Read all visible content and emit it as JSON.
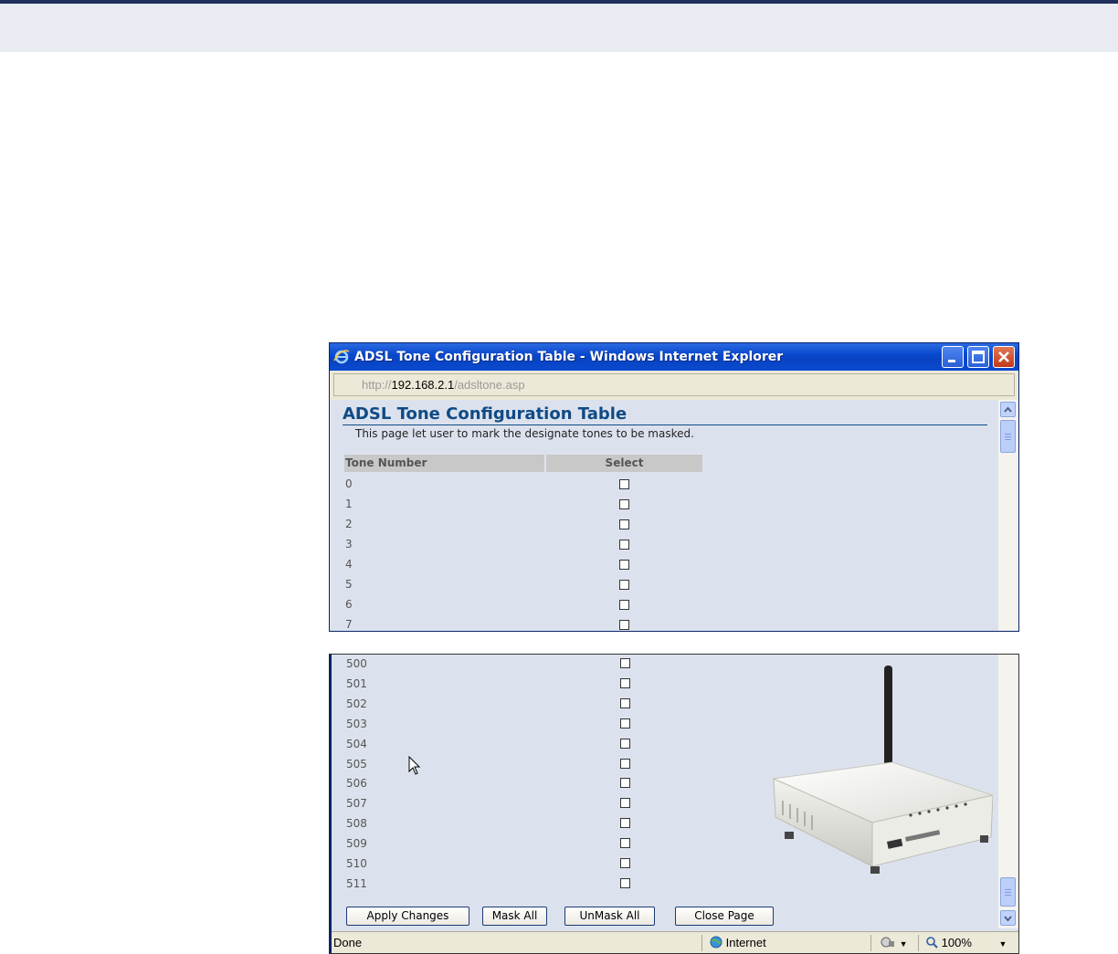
{
  "window": {
    "title": "ADSL Tone Configuration Table - Windows Internet Explorer",
    "address_scheme": "http://",
    "address_host": "192.168.2.1",
    "address_path": "/adsltone.asp"
  },
  "page": {
    "title": "ADSL Tone Configuration Table",
    "description": "This page let user to mark the designate tones to be masked."
  },
  "table": {
    "col_tone": "Tone Number",
    "col_select": "Select",
    "top_rows": [
      "0",
      "1",
      "2",
      "3",
      "4",
      "5",
      "6",
      "7"
    ],
    "bottom_rows": [
      "500",
      "501",
      "502",
      "503",
      "504",
      "505",
      "506",
      "507",
      "508",
      "509",
      "510",
      "511"
    ]
  },
  "buttons": {
    "apply": "Apply Changes",
    "mask_all": "Mask All",
    "unmask_all": "UnMask All",
    "close": "Close Page"
  },
  "status": {
    "text": "Done",
    "zone": "Internet",
    "zoom": "100%"
  },
  "colors": {
    "page_bg": "#dce2ed",
    "title_blue": "#0f4a86",
    "titlebar_blue": "#0a4ad0"
  },
  "icons": [
    "ie-logo-icon",
    "minimize-icon",
    "maximize-icon",
    "close-icon",
    "scroll-up-icon",
    "scroll-down-icon",
    "globe-icon",
    "security-icon",
    "zoom-icon",
    "mouse-pointer-icon"
  ]
}
